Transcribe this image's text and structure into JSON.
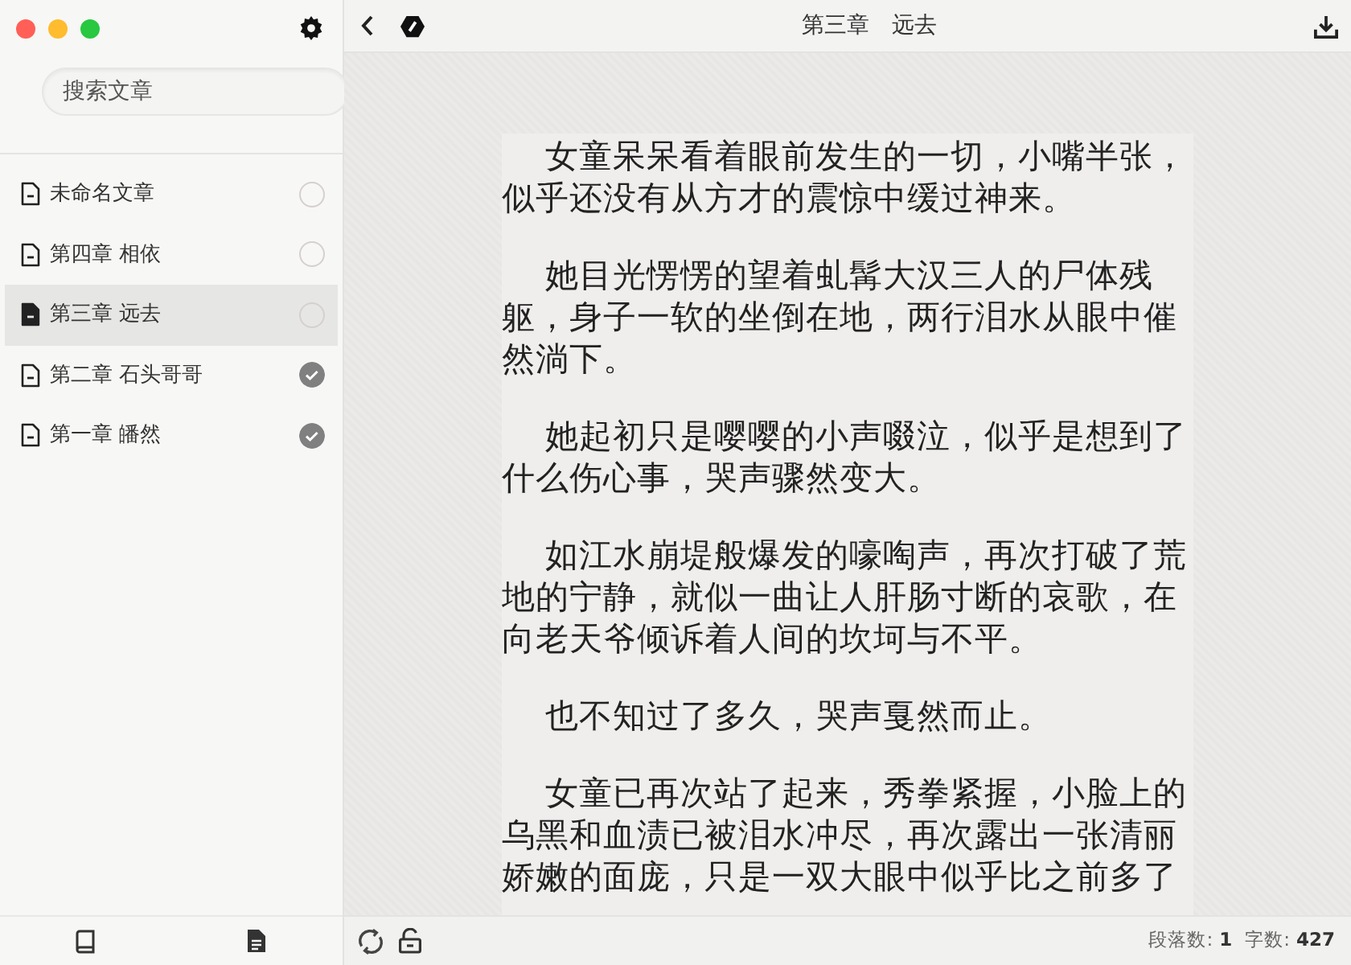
{
  "window": {
    "controls": [
      {
        "color": "#ff5f57"
      },
      {
        "color": "#febc2e"
      },
      {
        "color": "#28c840"
      }
    ]
  },
  "sidebar": {
    "search": {
      "placeholder": "搜索文章"
    },
    "articles": [
      {
        "title": "未命名文章",
        "selected": false,
        "done": false
      },
      {
        "title": "第四章 相依",
        "selected": false,
        "done": false
      },
      {
        "title": "第三章 远去",
        "selected": true,
        "done": false
      },
      {
        "title": "第二章 石头哥哥",
        "selected": false,
        "done": true
      },
      {
        "title": "第一章 皤然",
        "selected": false,
        "done": true
      }
    ]
  },
  "editor": {
    "title": "第三章　远去",
    "paragraphs": [
      "女童呆呆看着眼前发生的一切，小嘴半张，似乎还没有从方才的震惊中缓过神来。",
      "她目光愣愣的望着虬髯大汉三人的尸体残躯，身子一软的坐倒在地，两行泪水从眼中催然淌下。",
      "她起初只是嘤嘤的小声啜泣，似乎是想到了什么伤心事，哭声骤然变大。",
      "如江水崩堤般爆发的嚎啕声，再次打破了荒地的宁静，就似一曲让人肝肠寸断的哀歌，在向老天爷倾诉着人间的坎坷与不平。",
      "也不知过了多久，哭声戛然而止。",
      "女童已再次站了起来，秀拳紧握，小脸上的乌黑和血渍已被泪水冲尽，再次露出一张清丽娇嫩的面庞，只是一双大眼中似乎比之前多了"
    ]
  },
  "status_bar": {
    "paragraph_label": "段落数:",
    "paragraph_count": "1",
    "word_label": "字数:",
    "word_count": "427"
  }
}
